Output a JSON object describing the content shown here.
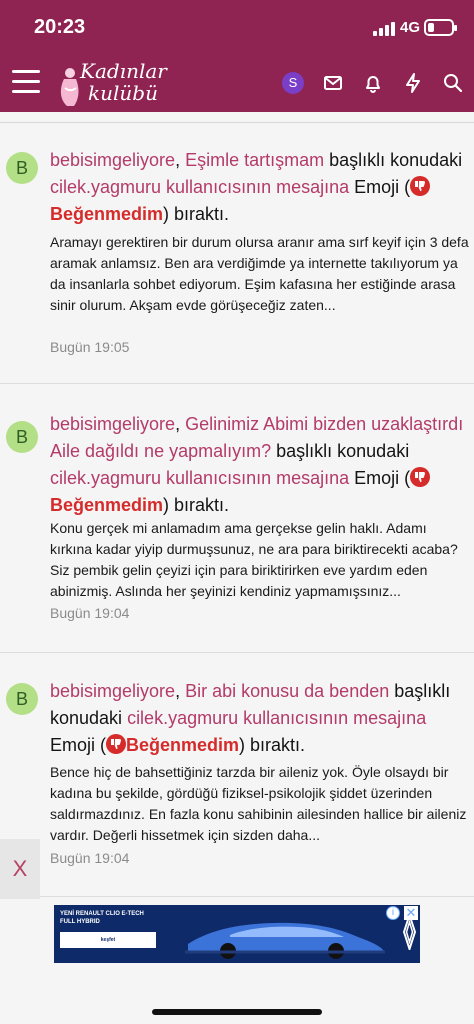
{
  "status": {
    "time": "20:23",
    "network": "4G",
    "battery_level": 0.25
  },
  "header": {
    "logo_line1": "Kadınlar",
    "logo_line2": "kulübü",
    "user_initial": "S",
    "icons": [
      "menu-icon",
      "mail-icon",
      "bell-icon",
      "bolt-icon",
      "search-icon"
    ]
  },
  "colors": {
    "header": "#8f2452",
    "link": "#b43b69",
    "reaction": "#d62b2b",
    "avatar": "#b3e086"
  },
  "notifications": [
    {
      "avatar": "B",
      "user": "bebisimgeliyore",
      "topic": "Eşimle tartışmam",
      "text_after_topic": " başlıklı konudaki ",
      "message_link": "cilek.yagmuru kullanıcısının mesajına",
      "emoji_prefix": " Emoji (",
      "reaction": "Beğenmedim",
      "emoji_suffix": ") bıraktı.",
      "snippet": "Aramayı gerektiren bir durum olursa aranır ama sırf keyif için 3 defa aramak anlamsız. Ben ara verdiğimde ya internette takılıyorum ya da insanlarla sohbet ediyorum. Eşim kafasına her estiğinde arasa sinir olurum. Akşam evde görüşeceğiz zaten...",
      "time": "Bugün 19:05"
    },
    {
      "avatar": "B",
      "user": "bebisimgeliyore",
      "topic": "Gelinimiz Abimi bizden uzaklaştırdı Aile dağıldı ne yapmalıyım?",
      "text_after_topic": " başlıklı konudaki ",
      "message_link": "cilek.yagmuru kullanıcısının mesajına",
      "emoji_prefix": " Emoji (",
      "reaction": "Beğenmedim",
      "emoji_suffix": ") bıraktı.",
      "snippet": "Konu gerçek mi anlamadım ama gerçekse gelin haklı. Adamı kırkına kadar yiyip durmuşsunuz, ne ara para biriktirecekti acaba? Siz pembik gelin çeyizi için para biriktirirken eve yardım eden abinizmiş. Aslında her şeyinizi kendiniz yapmamışsınız...",
      "time": "Bugün 19:04"
    },
    {
      "avatar": "B",
      "user": "bebisimgeliyore",
      "topic": "Bir abi konusu da benden",
      "text_after_topic": " başlıklı konudaki ",
      "message_link": "cilek.yagmuru kullanıcısının mesajına",
      "emoji_prefix": " Emoji (",
      "reaction": "Beğenmedim",
      "emoji_suffix": ") bıraktı.",
      "snippet": "Bence hiç de bahsettiğiniz tarzda bir aileniz yok. Öyle olsaydı bir kadına bu şekilde, gördüğü fiziksel-psikolojik şiddet üzerinden saldırmazdınız. En fazla konu sahibinin ailesinden hallice bir aileniz vardır. Değerli hissetmek için sizden daha...",
      "time": "Bugün 19:04"
    }
  ],
  "ad": {
    "close_label": "X",
    "headline": "YENİ RENAULT CLIO E-TECH FULL HYBRID",
    "cta": "keşfet",
    "info_label": "i",
    "dismiss_label": "✕"
  }
}
